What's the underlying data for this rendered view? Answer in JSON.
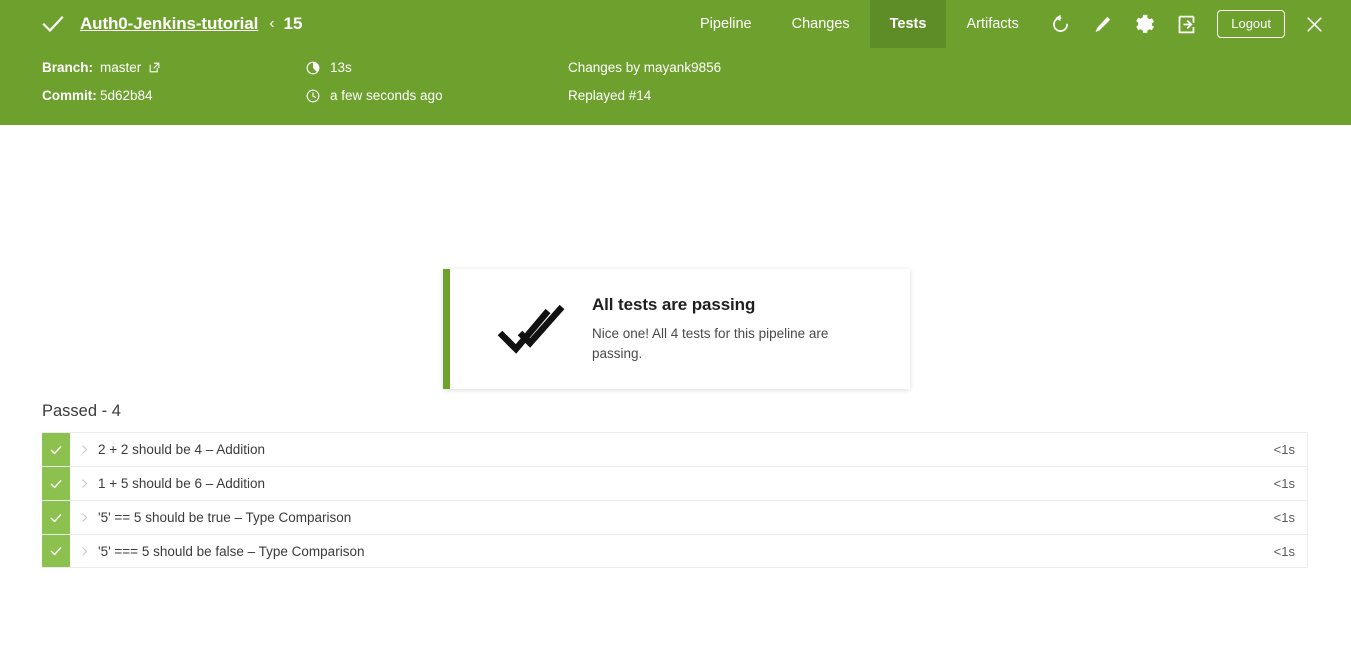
{
  "header": {
    "status_icon": "check-icon",
    "repo_name": "Auth0-Jenkins-tutorial",
    "separator": "‹",
    "run_number": "15",
    "tabs": [
      {
        "label": "Pipeline",
        "active": false
      },
      {
        "label": "Changes",
        "active": false
      },
      {
        "label": "Tests",
        "active": true
      },
      {
        "label": "Artifacts",
        "active": false
      }
    ],
    "actions": [
      {
        "name": "rerun-icon"
      },
      {
        "name": "edit-pencil-icon"
      },
      {
        "name": "settings-gear-icon"
      },
      {
        "name": "logout-arrow-icon"
      }
    ],
    "logout_label": "Logout",
    "close_label": "×",
    "background_color": "#6DA02D",
    "active_tab_color": "#5E8C26"
  },
  "metabar": {
    "branch_label": "Branch:",
    "branch_value": "master",
    "branch_link_icon": "external-link-icon",
    "commit_label": "Commit:",
    "commit_value": "5d62b84",
    "duration_icon": "duration-icon",
    "duration_value": "13s",
    "time_icon": "clock-icon",
    "time_value": "a few seconds ago",
    "changes_by": "Changes by mayank9856",
    "replayed": "Replayed #14"
  },
  "result_card": {
    "icon": "double-check-icon",
    "title": "All tests are passing",
    "description": "Nice one! All 4 tests for this pipeline are passing.",
    "accent_color": "#6DA02D"
  },
  "tests": {
    "section_title": "Passed - 4",
    "status_color": "#8CC04F",
    "rows": [
      {
        "status": "passed",
        "status_icon": "check-icon",
        "expander_icon": "chevron-right-icon",
        "name": "2 + 2 should be 4 – Addition",
        "duration": "<1s"
      },
      {
        "status": "passed",
        "status_icon": "check-icon",
        "expander_icon": "chevron-right-icon",
        "name": "1 + 5 should be 6 – Addition",
        "duration": "<1s"
      },
      {
        "status": "passed",
        "status_icon": "check-icon",
        "expander_icon": "chevron-right-icon",
        "name": "'5' == 5 should be true – Type Comparison",
        "duration": "<1s"
      },
      {
        "status": "passed",
        "status_icon": "check-icon",
        "expander_icon": "chevron-right-icon",
        "name": "'5' === 5 should be false – Type Comparison",
        "duration": "<1s"
      }
    ]
  }
}
